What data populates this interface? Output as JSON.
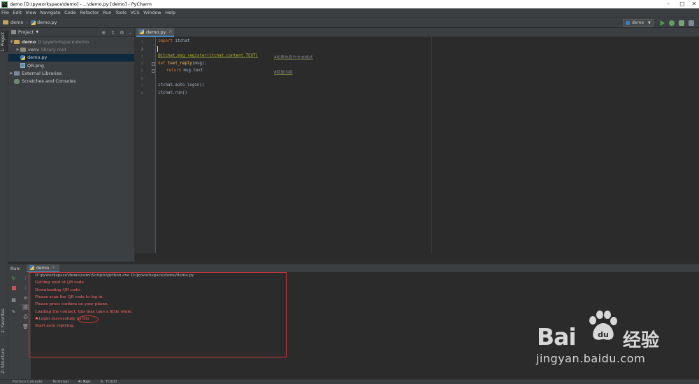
{
  "window": {
    "title": "demo [D:\\pyworkspace\\demo] - ...\\demo.py [demo] - PyCharm",
    "app_icon": "PC",
    "controls": [
      "minimize",
      "maximize",
      "close"
    ]
  },
  "menu": [
    "File",
    "Edit",
    "View",
    "Navigate",
    "Code",
    "Refactor",
    "Run",
    "Tools",
    "VCS",
    "Window",
    "Help"
  ],
  "breadcrumb": {
    "project": "demo",
    "file": "demo.py"
  },
  "run_config": {
    "name": "demo"
  },
  "left_stripe": {
    "project_tab": "1: Project",
    "favorites_tab": "2: Favorites",
    "structure_tab": "Z: Structure"
  },
  "project_panel": {
    "title": "Project",
    "tree": [
      {
        "label": "demo",
        "hint": "D:\\pyworkspace\\demo",
        "type": "folder",
        "expanded": true
      },
      {
        "label": "venv",
        "hint": "library root",
        "type": "venv",
        "expanded": false
      },
      {
        "label": "demo.py",
        "hint": "",
        "type": "py",
        "selected": true
      },
      {
        "label": "QR.png",
        "hint": "",
        "type": "png"
      },
      {
        "label": "External Libraries",
        "hint": "",
        "type": "lib",
        "expanded": false
      },
      {
        "label": "Scratches and Consoles",
        "hint": "",
        "type": "scratch"
      }
    ]
  },
  "editor": {
    "tab_label": "demo.py",
    "line_numbers": [
      "1",
      "2",
      "3",
      "4",
      "5",
      "6",
      "7",
      "8"
    ],
    "code": {
      "l1_kw": "import",
      "l1_rest": " itchat",
      "l3_deco": "@itchat.msg_register(itchat.content.TEXT)",
      "l3_comment": "#如果信息为文本格式",
      "l4_kw": "def",
      "l4_fn": " text_reply",
      "l4_rest": "(msg):",
      "l5_kw": "return",
      "l5_rest": " msg.text",
      "l5_comment": "#回复内容",
      "l7": "itchat.auto_login()",
      "l8": "itchat.run()"
    }
  },
  "run_panel": {
    "label": "Run:",
    "tab_label": "demo",
    "console": {
      "cmd": "D:\\pyworkspace\\demo\\venv\\Scripts\\python.exe D:/pyworkspace/demo/demo.py",
      "lines": [
        "Getting uuid of QR code.",
        "Downloading QR code.",
        "Please scan the QR code to log in.",
        "Please press confirm on your phone.",
        "Loading the contact, this may take a little while.",
        "♣Login successfully as GG",
        "Start auto replying."
      ]
    }
  },
  "bottom_bar": [
    "Python Console",
    "Terminal",
    "4: Run",
    "6: TODO"
  ],
  "watermark": {
    "brand": "Bai",
    "brand_cn": "经验",
    "url": "jingyan.baidu.com"
  },
  "colors": {
    "selection": "#0d293e",
    "accent": "#4a88c7",
    "error_text": "#ff6b68",
    "annotation_red": "#d03838"
  }
}
